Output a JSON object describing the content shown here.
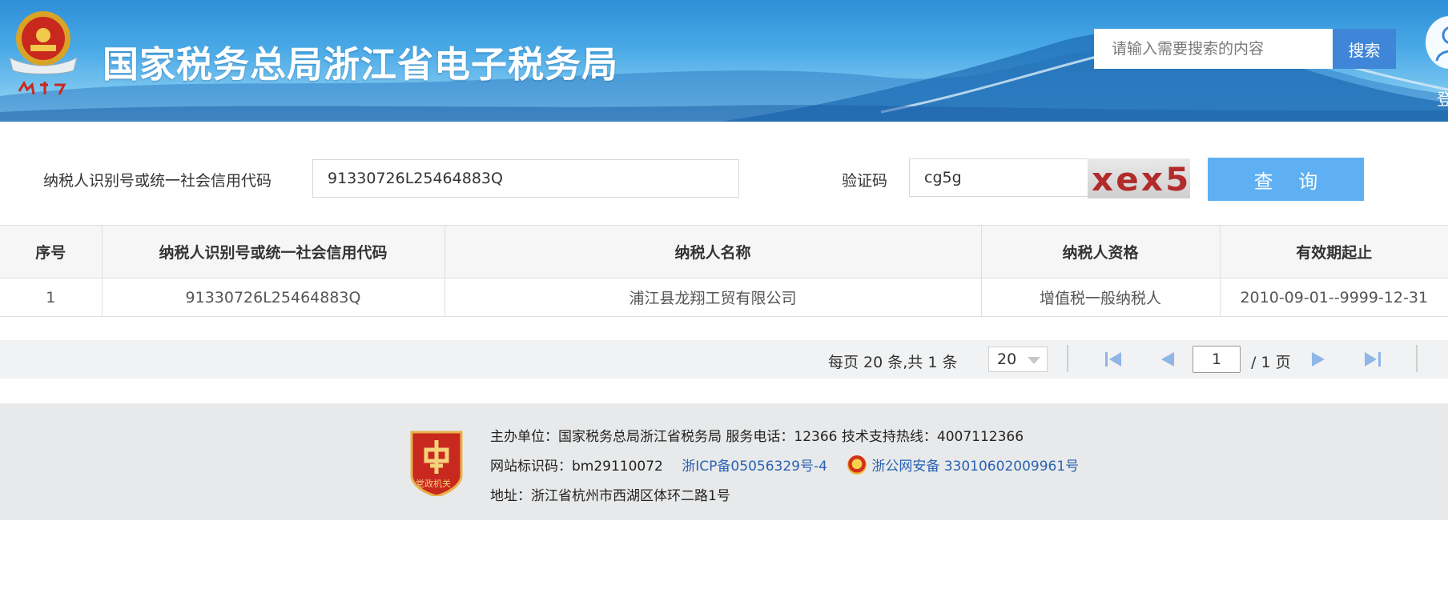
{
  "header": {
    "site_title": "国家税务总局浙江省电子税务局",
    "search_placeholder": "请输入需要搜索的内容",
    "search_button": "搜索",
    "login_label": "登",
    "emblem_caption": "中国税务"
  },
  "query_form": {
    "taxpayer_id_label": "纳税人识别号或统一社会信用代码",
    "taxpayer_id_value": "91330726L25464883Q",
    "captcha_label": "验证码",
    "captcha_value": "cg5g",
    "captcha_image_text": "xex5",
    "query_button": "查 询"
  },
  "table": {
    "columns": [
      "序号",
      "纳税人识别号或统一社会信用代码",
      "纳税人名称",
      "纳税人资格",
      "有效期起止"
    ],
    "rows": [
      [
        "1",
        "91330726L25464883Q",
        "浦江县龙翔工贸有限公司",
        "增值税一般纳税人",
        "2010-09-01--9999-12-31"
      ]
    ]
  },
  "pagination": {
    "summary": "每页 20 条,共 1 条",
    "page_size": "20",
    "current_page": "1",
    "total_pages": "/ 1 页"
  },
  "footer": {
    "line1": "主办单位：国家税务总局浙江省税务局    服务电话：12366    技术支持热线：4007112366",
    "site_id": "网站标识码：bm29110072",
    "icp": "浙ICP备05056329号-4",
    "police_record": "浙公网安备 33010602009961号",
    "address": "地址：浙江省杭州市西湖区体环二路1号",
    "badge_text": "党政机关"
  },
  "colors": {
    "banner": "#49a9e6",
    "search_button": "#3f86d8",
    "query_button": "#5eb0f2",
    "link": "#2a63b4",
    "pager_icons": "#8fb6e6"
  }
}
